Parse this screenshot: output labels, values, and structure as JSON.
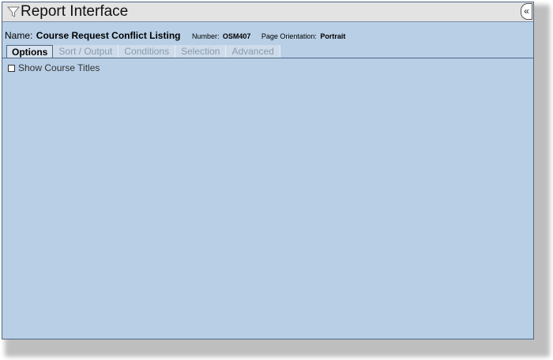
{
  "window": {
    "title": "Report Interface",
    "collapse_label": "«"
  },
  "report": {
    "name_label": "Name:",
    "name_value": "Course Request Conflict Listing",
    "number_label": "Number:",
    "number_value": "OSM407",
    "orientation_label": "Page Orientation:",
    "orientation_value": "Portrait"
  },
  "tabs": [
    {
      "label": "Options",
      "active": true
    },
    {
      "label": "Sort / Output",
      "active": false
    },
    {
      "label": "Conditions",
      "active": false
    },
    {
      "label": "Selection",
      "active": false
    },
    {
      "label": "Advanced",
      "active": false
    }
  ],
  "options": {
    "show_course_titles": {
      "label": "Show Course Titles",
      "checked": false
    }
  },
  "icons": {
    "title_icon": "filter-icon"
  },
  "colors": {
    "panel_bg": "#b8cfe6",
    "titlebar_bg": "#e3e3e3",
    "border": "#4d6785"
  }
}
